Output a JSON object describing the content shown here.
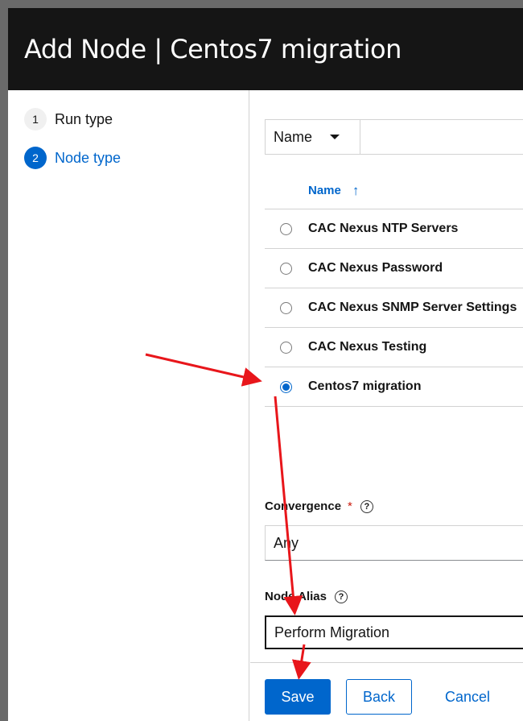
{
  "modal": {
    "title": "Add Node | Centos7 migration"
  },
  "wizard": {
    "steps": [
      {
        "number": "1",
        "label": "Run type",
        "active": false
      },
      {
        "number": "2",
        "label": "Node type",
        "active": true
      }
    ]
  },
  "filter": {
    "selected": "Name"
  },
  "table": {
    "column": "Name",
    "rows": [
      {
        "name": "CAC Nexus NTP Servers",
        "selected": false
      },
      {
        "name": "CAC Nexus Password",
        "selected": false
      },
      {
        "name": "CAC Nexus SNMP Server Settings",
        "selected": false
      },
      {
        "name": "CAC Nexus Testing",
        "selected": false
      },
      {
        "name": "Centos7 migration",
        "selected": true
      }
    ]
  },
  "convergence": {
    "label": "Convergence",
    "required": "*",
    "value": "Any"
  },
  "node_alias": {
    "label": "Node Alias",
    "value": "Perform Migration"
  },
  "footer": {
    "save": "Save",
    "back": "Back",
    "cancel": "Cancel"
  },
  "colors": {
    "accent": "#0066cc",
    "header": "#151515",
    "annotation": "#e8161b"
  },
  "icons": {
    "help": "question-circle-icon",
    "sort": "sort-ascending-icon",
    "caret": "caret-down-icon"
  }
}
